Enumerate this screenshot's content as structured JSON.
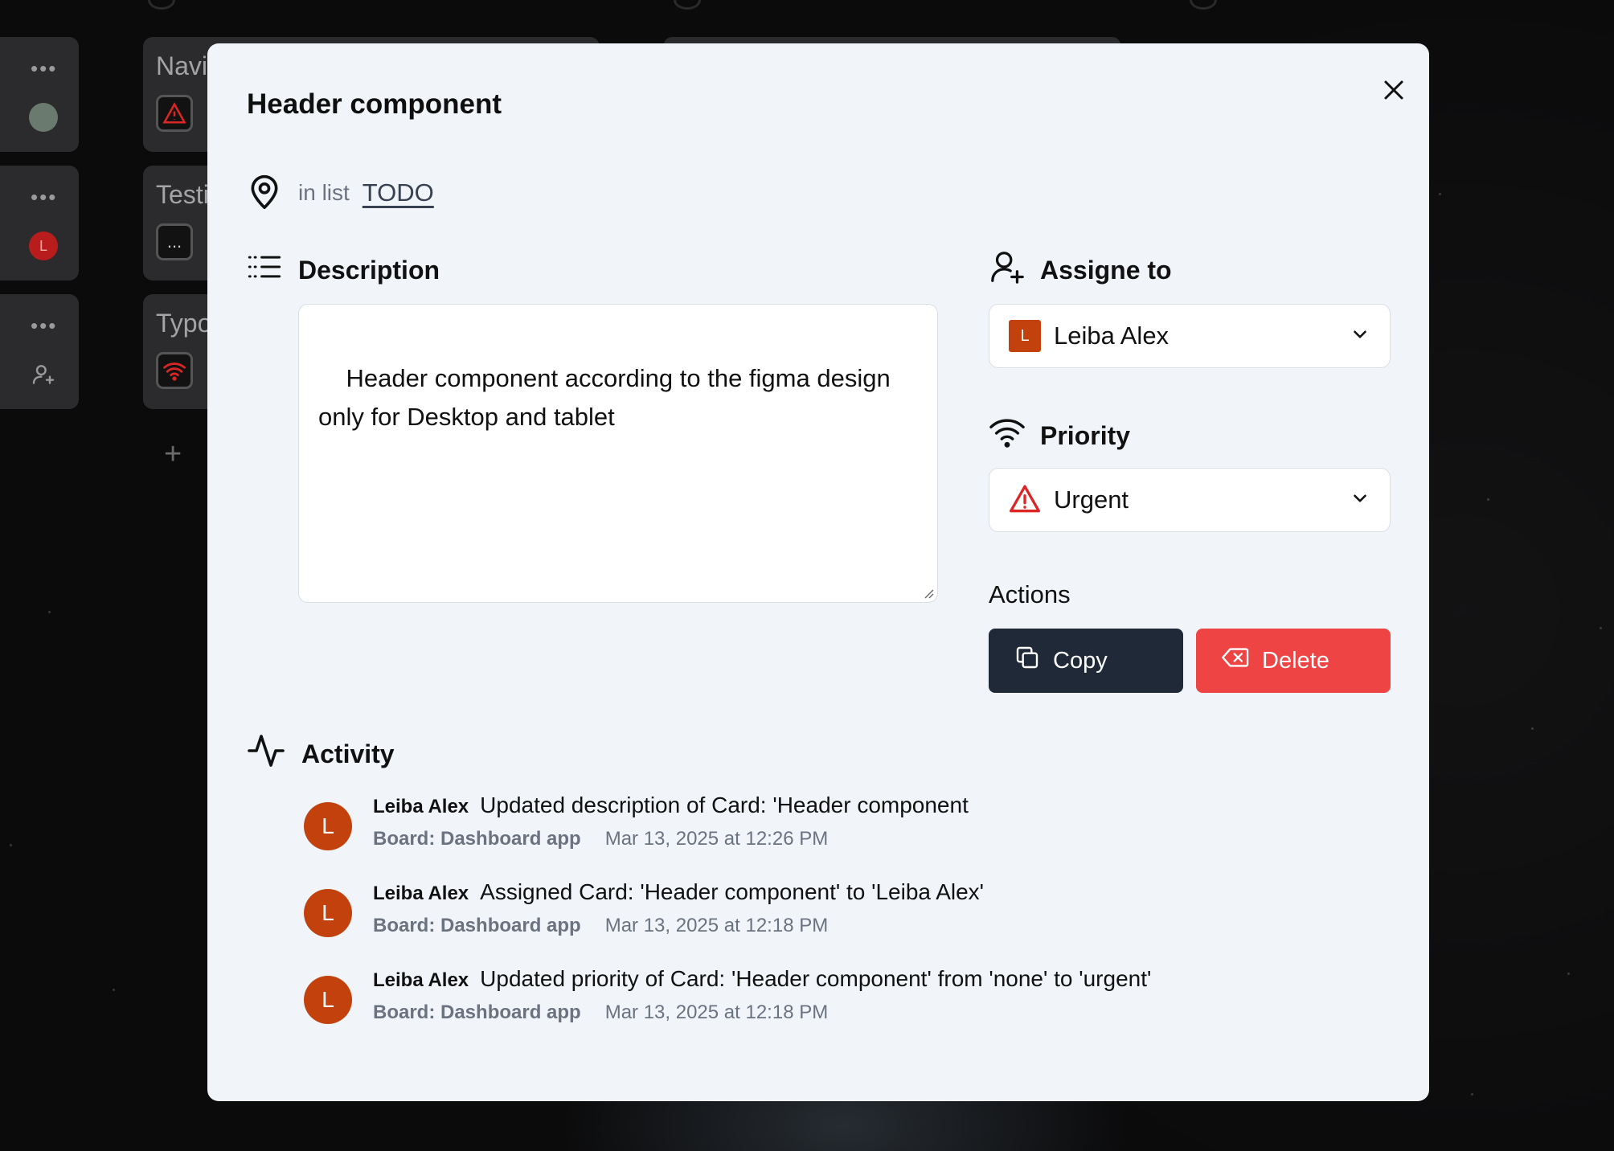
{
  "background_board": {
    "cards": [
      {
        "title": "Navi"
      },
      {
        "title": "Testi"
      },
      {
        "title": "Typo"
      }
    ],
    "side_assignee_initial": "L",
    "badge_more_text": "..."
  },
  "modal": {
    "title": "Header component",
    "in_list_label": "in list",
    "list_name": "TODO",
    "description": {
      "heading": "Description",
      "text": "Header component according to the figma design\nonly for Desktop and tablet"
    },
    "assignee": {
      "heading": "Assigne to",
      "initial": "L",
      "name": "Leiba Alex"
    },
    "priority": {
      "heading": "Priority",
      "value": "Urgent",
      "color": "#dc2626"
    },
    "actions": {
      "heading": "Actions",
      "copy_label": "Copy",
      "delete_label": "Delete",
      "copy_color": "#1f2937",
      "delete_color": "#ef4444"
    },
    "activity": {
      "heading": "Activity",
      "items": [
        {
          "initial": "L",
          "user": "Leiba Alex",
          "text": "Updated description of Card: 'Header component",
          "board": "Board: Dashboard app",
          "time": "Mar 13, 2025 at 12:26 PM"
        },
        {
          "initial": "L",
          "user": "Leiba Alex",
          "text": "Assigned Card: 'Header component' to 'Leiba Alex'",
          "board": "Board: Dashboard app",
          "time": "Mar 13, 2025 at 12:18 PM"
        },
        {
          "initial": "L",
          "user": "Leiba Alex",
          "text": "Updated priority of Card: 'Header component' from 'none' to 'urgent'",
          "board": "Board: Dashboard app",
          "time": "Mar 13, 2025 at 12:18 PM"
        }
      ]
    }
  }
}
